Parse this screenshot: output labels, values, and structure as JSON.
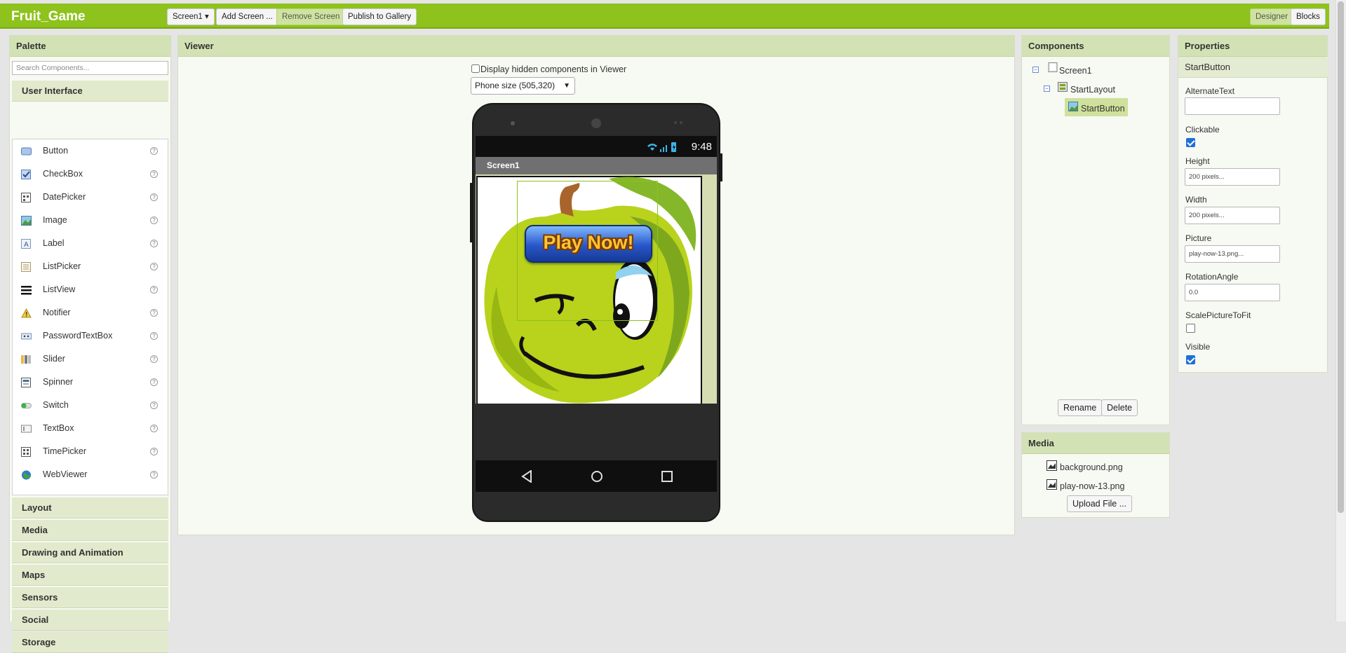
{
  "app": {
    "title": "Fruit_Game"
  },
  "toolbar": {
    "screen_select": "Screen1 ▾",
    "add_screen": "Add Screen ...",
    "remove_screen": "Remove Screen",
    "publish": "Publish to Gallery",
    "designer": "Designer",
    "blocks": "Blocks"
  },
  "palette": {
    "title": "Palette",
    "search_placeholder": "Search Components...",
    "open_category": "User Interface",
    "items": [
      {
        "label": "Button",
        "icon": "button-icon"
      },
      {
        "label": "CheckBox",
        "icon": "checkbox-icon"
      },
      {
        "label": "DatePicker",
        "icon": "datepicker-icon"
      },
      {
        "label": "Image",
        "icon": "image-icon"
      },
      {
        "label": "Label",
        "icon": "label-icon"
      },
      {
        "label": "ListPicker",
        "icon": "listpicker-icon"
      },
      {
        "label": "ListView",
        "icon": "listview-icon"
      },
      {
        "label": "Notifier",
        "icon": "notifier-icon"
      },
      {
        "label": "PasswordTextBox",
        "icon": "password-icon"
      },
      {
        "label": "Slider",
        "icon": "slider-icon"
      },
      {
        "label": "Spinner",
        "icon": "spinner-icon"
      },
      {
        "label": "Switch",
        "icon": "switch-icon"
      },
      {
        "label": "TextBox",
        "icon": "textbox-icon"
      },
      {
        "label": "TimePicker",
        "icon": "timepicker-icon"
      },
      {
        "label": "WebViewer",
        "icon": "webviewer-icon"
      }
    ],
    "help_glyph": "?",
    "categories": [
      "Layout",
      "Media",
      "Drawing and Animation",
      "Maps",
      "Sensors",
      "Social",
      "Storage"
    ]
  },
  "viewer": {
    "title": "Viewer",
    "hidden_label": "Display hidden components in Viewer",
    "size_option": "Phone size (505,320)",
    "clock": "9:48",
    "screen_title": "Screen1",
    "play_button_text": "Play Now!"
  },
  "components": {
    "title": "Components",
    "tree": [
      "Screen1",
      "StartLayout",
      "StartButton"
    ],
    "rename": "Rename",
    "delete": "Delete"
  },
  "media": {
    "title": "Media",
    "files": [
      "background.png",
      "play-now-13.png"
    ],
    "upload": "Upload File ..."
  },
  "properties": {
    "title": "Properties",
    "component": "StartButton",
    "alternate_text_label": "AlternateText",
    "alternate_text_value": "",
    "clickable_label": "Clickable",
    "clickable": true,
    "height_label": "Height",
    "height_value": "200 pixels...",
    "width_label": "Width",
    "width_value": "200 pixels...",
    "picture_label": "Picture",
    "picture_value": "play-now-13.png...",
    "rotation_label": "RotationAngle",
    "rotation_value": "0.0",
    "scale_label": "ScalePictureToFit",
    "scale": false,
    "visible_label": "Visible",
    "visible": true
  },
  "colors": {
    "brand": "#8ec21c",
    "panel_header": "#d3e2b5",
    "selection": "#cfe19c"
  }
}
